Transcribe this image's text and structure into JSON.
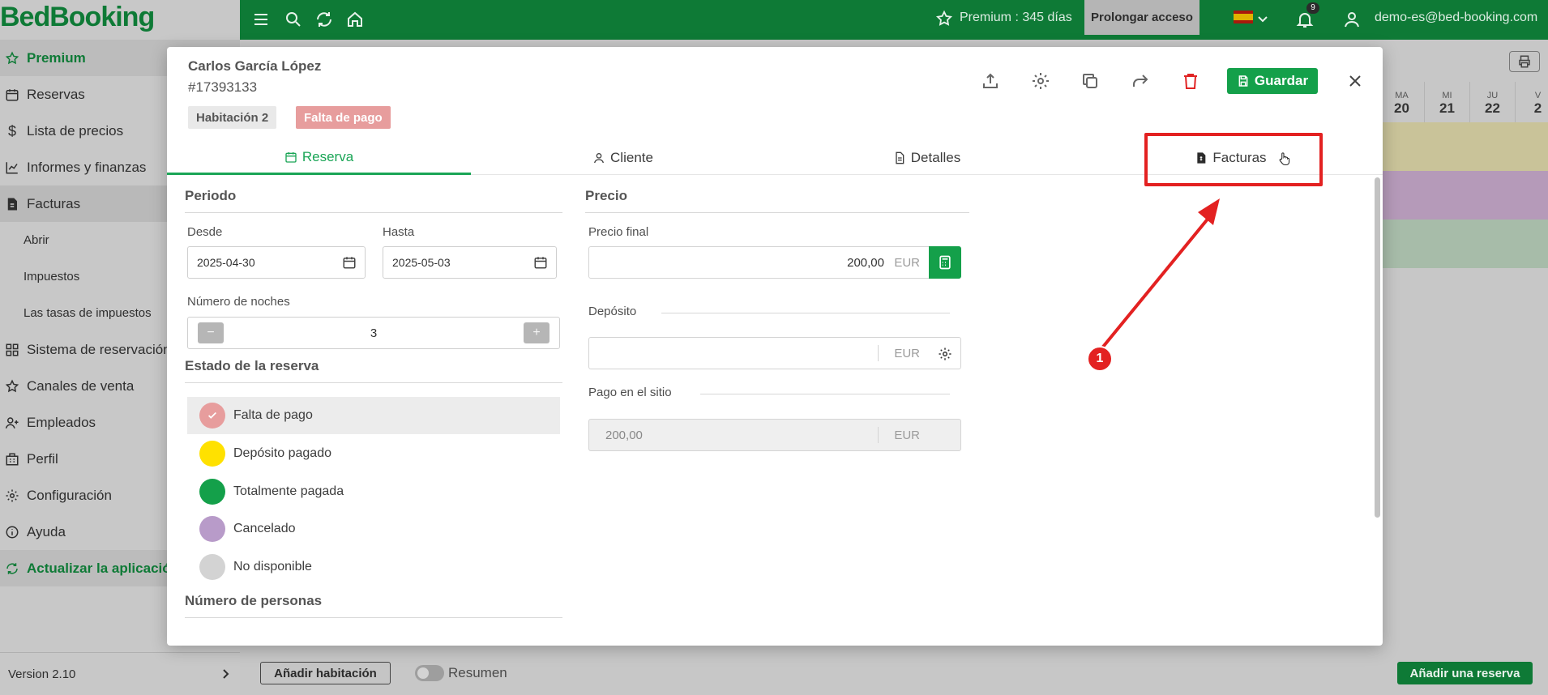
{
  "app": {
    "logo": "BedBooking",
    "premium_label": "Premium : 345 días",
    "prolong_label": "Prolongar acceso",
    "notifications_count": "9",
    "user_email": "demo-es@bed-booking.com"
  },
  "sidebar": {
    "items": [
      {
        "label": "Premium"
      },
      {
        "label": "Reservas"
      },
      {
        "label": "Lista de precios"
      },
      {
        "label": "Informes y finanzas"
      },
      {
        "label": "Facturas"
      },
      {
        "label": "Abrir"
      },
      {
        "label": "Impuestos"
      },
      {
        "label": "Las tasas de impuestos"
      },
      {
        "label": "Sistema de reservación"
      },
      {
        "label": "Canales de venta"
      },
      {
        "label": "Empleados"
      },
      {
        "label": "Perfil"
      },
      {
        "label": "Configuración"
      },
      {
        "label": "Ayuda"
      },
      {
        "label": "Actualizar la aplicación"
      }
    ],
    "version": "Version 2.10"
  },
  "calendar": {
    "days": [
      {
        "dow": "MA",
        "num": "20"
      },
      {
        "dow": "MI",
        "num": "21"
      },
      {
        "dow": "JU",
        "num": "22"
      },
      {
        "dow": "V",
        "num": "2"
      }
    ],
    "row_colors": [
      "#c9c399",
      "#b59ab9",
      "#a7bca9"
    ]
  },
  "bottom": {
    "add_room": "Añadir habitación",
    "summary_toggle": "Resumen",
    "add_reservation": "Añadir una reserva"
  },
  "modal": {
    "guest_name": "Carlos García López",
    "booking_id": "#17393133",
    "room_chip": "Habitación 2",
    "status_chip": "Falta de pago",
    "save_label": "Guardar",
    "tabs": [
      {
        "label": "Reserva"
      },
      {
        "label": "Cliente"
      },
      {
        "label": "Detalles"
      },
      {
        "label": "Facturas"
      }
    ],
    "period": {
      "title": "Periodo",
      "from_label": "Desde",
      "from_value": "2025-04-30",
      "to_label": "Hasta",
      "to_value": "2025-05-03",
      "nights_label": "Número de noches",
      "nights_value": "3",
      "minus": "−",
      "plus": "+"
    },
    "status": {
      "title": "Estado de la reserva",
      "options": [
        {
          "label": "Falta de pago",
          "color": "#e79d9d"
        },
        {
          "label": "Depósito pagado",
          "color": "#ffe100"
        },
        {
          "label": "Totalmente pagada",
          "color": "#14a04a"
        },
        {
          "label": "Cancelado",
          "color": "#b89bc9"
        },
        {
          "label": "No disponible",
          "color": "#d3d3d3"
        }
      ]
    },
    "persons": {
      "title": "Número de personas"
    },
    "price": {
      "title": "Precio",
      "final_label": "Precio final",
      "final_value": "200,00",
      "currency": "EUR",
      "deposit_label": "Depósito",
      "deposit_currency": "EUR",
      "onsite_label": "Pago en el sitio",
      "onsite_value": "200,00",
      "onsite_currency": "EUR"
    }
  },
  "annotation": {
    "number": "1",
    "color": "#e32121"
  }
}
